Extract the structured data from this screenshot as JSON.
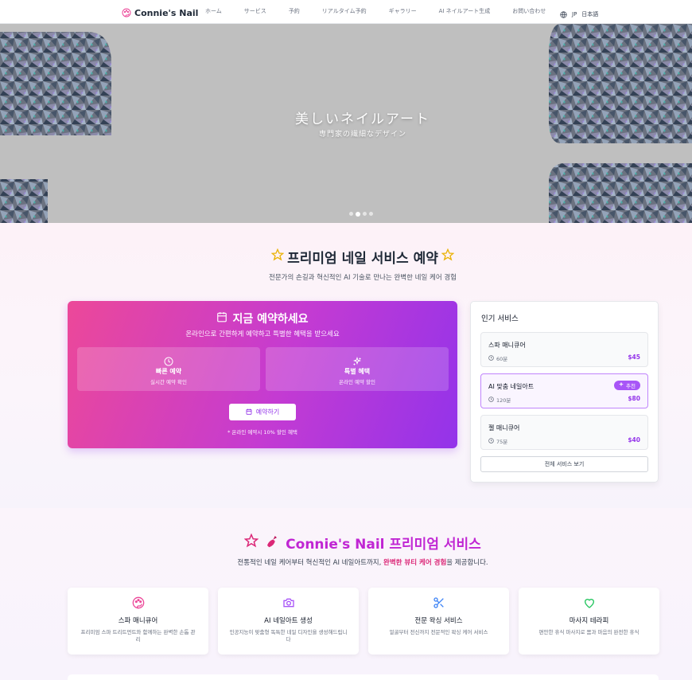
{
  "nav": {
    "brand": "Connie's Nail",
    "links": [
      "ホーム",
      "サービス",
      "予約",
      "リアルタイム予約",
      "ギャラリー",
      "AI ネイルアート生成",
      "お問い合わせ"
    ],
    "lang_code": "JP",
    "lang_label": "日本語"
  },
  "hero": {
    "title": "美しいネイルアート",
    "subtitle": "専門家の繊細なデザイン",
    "slides": 4,
    "active_slide": 2
  },
  "booking": {
    "title": "프리미엄 네일 서비스 예약",
    "subtitle": "전문가의 손길과 혁신적인 AI 기술로 만나는 완벽한 네일 케어 경험",
    "card": {
      "title": "지금 예약하세요",
      "subtitle": "온라인으로 간편하게 예약하고 특별한 혜택을 받으세요",
      "features": [
        {
          "title": "빠른 예약",
          "desc": "실시간 예약 확인",
          "icon": "clock-icon"
        },
        {
          "title": "특별 혜택",
          "desc": "온라인 예약 할인",
          "icon": "sparkles-icon"
        }
      ],
      "button": "예약하기",
      "note": "* 온라인 예약시 10% 할인 혜택"
    },
    "popular": {
      "title": "인기 서비스",
      "services": [
        {
          "name": "스파 매니큐어",
          "time": "60분",
          "price": "$45",
          "badge": ""
        },
        {
          "name": "AI 맞춤 네일아트",
          "time": "120분",
          "price": "$80",
          "badge": "추천"
        },
        {
          "name": "젤 매니큐어",
          "time": "75분",
          "price": "$40",
          "badge": ""
        }
      ],
      "all_button": "전체 서비스 보기"
    }
  },
  "premium": {
    "title": "Connie's Nail 프리미엄 서비스",
    "subtitle_pre": "전통적인 네일 케어부터 혁신적인 AI 네일아트까지, ",
    "subtitle_hl": "완벽한 뷰티 케어 경험",
    "subtitle_post": "을 제공합니다.",
    "cards": [
      {
        "title": "스파 매니큐어",
        "desc": "프리미엄 스파 트리트먼트와 함께하는 완벽한 손톱 관리",
        "icon": "palette-icon",
        "color": "#ec4899"
      },
      {
        "title": "AI 네일아트 생성",
        "desc": "인공지능이 맞춤형 독특한 네일 디자인을 생성해드립니다",
        "icon": "camera-icon",
        "color": "#a855f7"
      },
      {
        "title": "전문 왁싱 서비스",
        "desc": "얼굴부터 전신까지 전문적인 왁싱 케어 서비스",
        "icon": "scissors-icon",
        "color": "#3b82f6"
      },
      {
        "title": "마사지 테라피",
        "desc": "편안한 휴식 마사지로 몸과 마음의 완전한 휴식",
        "icon": "heart-icon",
        "color": "#22c55e"
      }
    ]
  },
  "colors": {
    "brand_pink": "#ec4899",
    "brand_purple": "#9333ea",
    "accent_magenta": "#c026d3"
  }
}
